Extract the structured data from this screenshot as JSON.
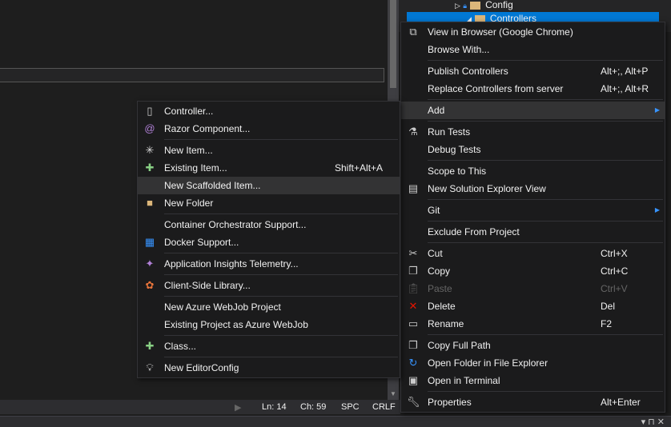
{
  "solution_explorer": {
    "rows": [
      {
        "label": "Config"
      },
      {
        "label": "Controllers",
        "selected": true
      }
    ]
  },
  "status_bar": {
    "line": "Ln: 14",
    "col": "Ch: 59",
    "spacing": "SPC",
    "eol": "CRLF"
  },
  "bottom_panel": {
    "controls": "▾ ⊓ ✕"
  },
  "context_menu": {
    "items": [
      {
        "label": "View in Browser (Google Chrome)",
        "icon": "browser-icon"
      },
      {
        "label": "Browse With..."
      },
      {
        "sep": true
      },
      {
        "label": "Publish Controllers",
        "shortcut": "Alt+;, Alt+P"
      },
      {
        "label": "Replace Controllers from server",
        "shortcut": "Alt+;, Alt+R"
      },
      {
        "sep": true
      },
      {
        "label": "Add",
        "submenu": true,
        "hover": true
      },
      {
        "sep": true
      },
      {
        "label": "Run Tests",
        "icon": "flask-icon"
      },
      {
        "label": "Debug Tests"
      },
      {
        "sep": true
      },
      {
        "label": "Scope to This"
      },
      {
        "label": "New Solution Explorer View",
        "icon": "new-view-icon"
      },
      {
        "sep": true
      },
      {
        "label": "Git",
        "submenu": true
      },
      {
        "sep": true
      },
      {
        "label": "Exclude From Project"
      },
      {
        "sep": true
      },
      {
        "label": "Cut",
        "shortcut": "Ctrl+X",
        "icon": "scissors-icon"
      },
      {
        "label": "Copy",
        "shortcut": "Ctrl+C",
        "icon": "copy-icon"
      },
      {
        "label": "Paste",
        "shortcut": "Ctrl+V",
        "icon": "paste-icon",
        "disabled": true
      },
      {
        "label": "Delete",
        "shortcut": "Del",
        "icon": "delete-icon"
      },
      {
        "label": "Rename",
        "shortcut": "F2",
        "icon": "rename-icon"
      },
      {
        "sep": true
      },
      {
        "label": "Copy Full Path",
        "icon": "copy-path-icon"
      },
      {
        "label": "Open Folder in File Explorer",
        "icon": "refresh-folder-icon"
      },
      {
        "label": "Open in Terminal",
        "icon": "terminal-icon"
      },
      {
        "sep": true
      },
      {
        "label": "Properties",
        "shortcut": "Alt+Enter",
        "icon": "wrench-icon"
      }
    ]
  },
  "add_submenu": {
    "items": [
      {
        "label": "Controller...",
        "icon": "controller-file-icon"
      },
      {
        "label": "Razor Component...",
        "icon": "razor-icon"
      },
      {
        "sep": true
      },
      {
        "label": "New Item...",
        "icon": "new-item-icon"
      },
      {
        "label": "Existing Item...",
        "shortcut": "Shift+Alt+A",
        "icon": "existing-item-icon"
      },
      {
        "label": "New Scaffolded Item...",
        "hover": true
      },
      {
        "label": "New Folder",
        "icon": "new-folder-icon"
      },
      {
        "sep": true
      },
      {
        "label": "Container Orchestrator Support..."
      },
      {
        "label": "Docker Support...",
        "icon": "docker-icon"
      },
      {
        "sep": true
      },
      {
        "label": "Application Insights Telemetry...",
        "icon": "insights-icon"
      },
      {
        "sep": true
      },
      {
        "label": "Client-Side Library...",
        "icon": "library-icon"
      },
      {
        "sep": true
      },
      {
        "label": "New Azure WebJob Project"
      },
      {
        "label": "Existing Project as Azure WebJob"
      },
      {
        "sep": true
      },
      {
        "label": "Class...",
        "icon": "class-icon"
      },
      {
        "sep": true
      },
      {
        "label": "New EditorConfig",
        "icon": "editorconfig-icon"
      }
    ]
  },
  "colors": {
    "selection": "#0078d4",
    "menu_bg": "#1b1b1c",
    "hover": "#333334"
  }
}
